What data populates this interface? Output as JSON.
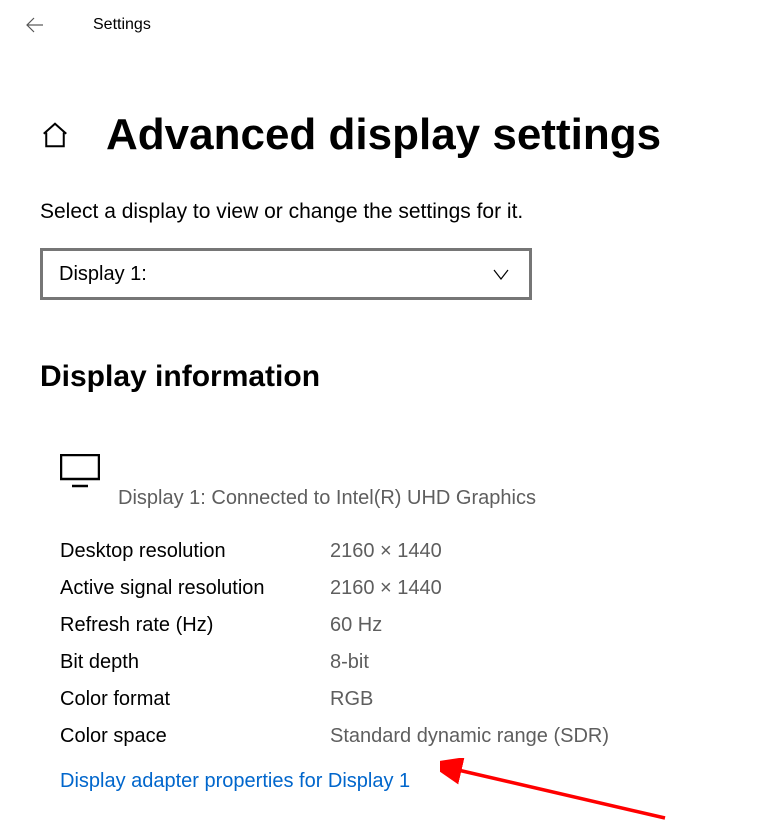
{
  "header": {
    "title": "Settings"
  },
  "page": {
    "title": "Advanced display settings",
    "instruction": "Select a display to view or change the settings for it."
  },
  "dropdown": {
    "selected": "Display 1:"
  },
  "section": {
    "heading": "Display information"
  },
  "monitor": {
    "label": "Display 1: Connected to Intel(R) UHD Graphics"
  },
  "info": [
    {
      "label": "Desktop resolution",
      "value": "2160 × 1440"
    },
    {
      "label": "Active signal resolution",
      "value": "2160 × 1440"
    },
    {
      "label": "Refresh rate (Hz)",
      "value": "60 Hz"
    },
    {
      "label": "Bit depth",
      "value": "8-bit"
    },
    {
      "label": "Color format",
      "value": "RGB"
    },
    {
      "label": "Color space",
      "value": "Standard dynamic range (SDR)"
    }
  ],
  "link": {
    "text": "Display adapter properties for Display 1"
  }
}
